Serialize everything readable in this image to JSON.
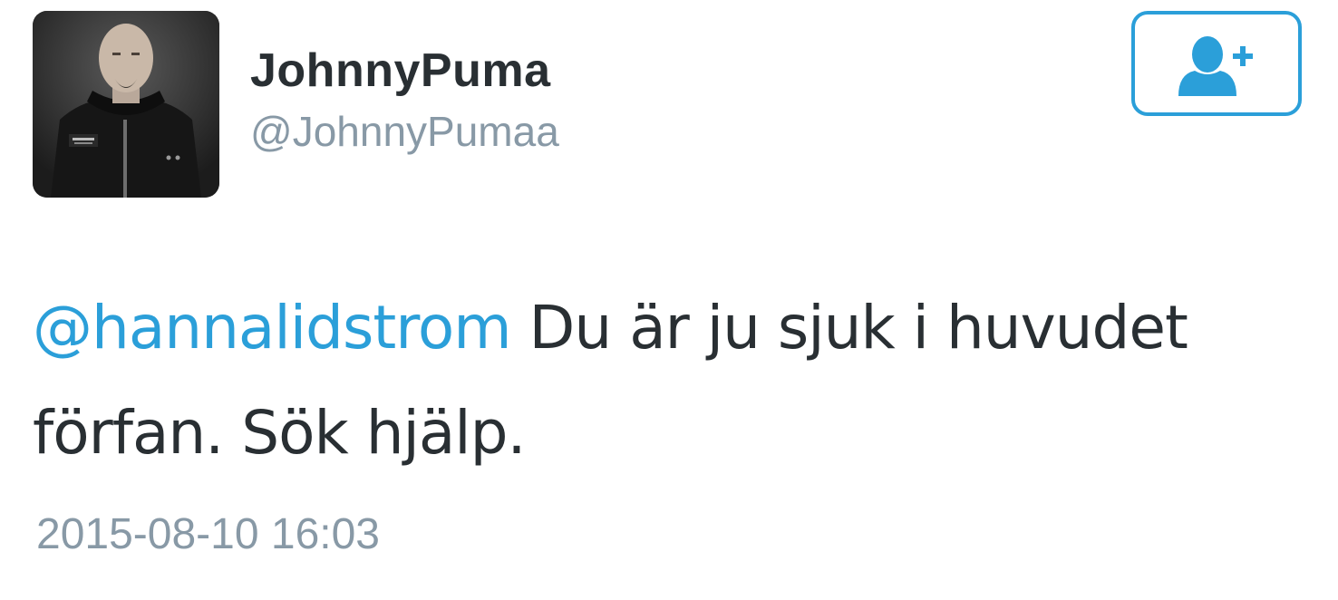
{
  "user": {
    "display_name": "JohnnyPuma",
    "handle": "@JohnnyPumaa",
    "avatar_icon": "profile-photo"
  },
  "follow_button": {
    "icon": "add-user-icon",
    "accent_color": "#2b9fd9"
  },
  "tweet": {
    "mention": "@hannalidstrom",
    "text": " Du är ju sjuk i huvudet förfan. Sök hjälp.",
    "timestamp": "2015-08-10 16:03"
  },
  "colors": {
    "text": "#292f33",
    "secondary": "#8899a6",
    "link": "#2b9fd9"
  }
}
